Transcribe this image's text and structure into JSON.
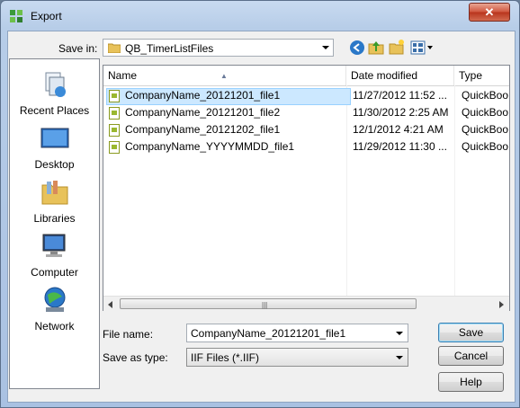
{
  "window": {
    "title": "Export",
    "close_glyph": "✕"
  },
  "toolbar": {
    "save_in_label": "Save in:",
    "folder": "QB_TimerListFiles",
    "icons": [
      "back-icon",
      "up-folder-icon",
      "new-folder-icon",
      "view-menu-icon"
    ]
  },
  "places": [
    {
      "label": "Recent Places",
      "icon": "recent-places-icon"
    },
    {
      "label": "Desktop",
      "icon": "desktop-icon"
    },
    {
      "label": "Libraries",
      "icon": "libraries-icon"
    },
    {
      "label": "Computer",
      "icon": "computer-icon"
    },
    {
      "label": "Network",
      "icon": "network-icon"
    }
  ],
  "columns": {
    "name": "Name",
    "date": "Date modified",
    "type": "Type"
  },
  "files": [
    {
      "name": "CompanyName_20121201_file1",
      "date": "11/27/2012 11:52 ...",
      "type": "QuickBoo"
    },
    {
      "name": "CompanyName_20121201_file2",
      "date": "11/30/2012 2:25 AM",
      "type": "QuickBoo"
    },
    {
      "name": "CompanyName_20121202_file1",
      "date": "12/1/2012 4:21 AM",
      "type": "QuickBoo"
    },
    {
      "name": "CompanyName_YYYYMMDD_file1",
      "date": "11/29/2012 11:30 ...",
      "type": "QuickBoo"
    }
  ],
  "form": {
    "file_name_label": "File name:",
    "file_name_value": "CompanyName_20121201_file1",
    "save_type_label": "Save as type:",
    "save_type_value": "IIF Files (*.IIF)"
  },
  "buttons": {
    "save": "Save",
    "cancel": "Cancel",
    "help": "Help"
  },
  "colors": {
    "selection": "#cce8ff",
    "title_bar": "#b7cde8",
    "close_button": "#c84a32"
  }
}
